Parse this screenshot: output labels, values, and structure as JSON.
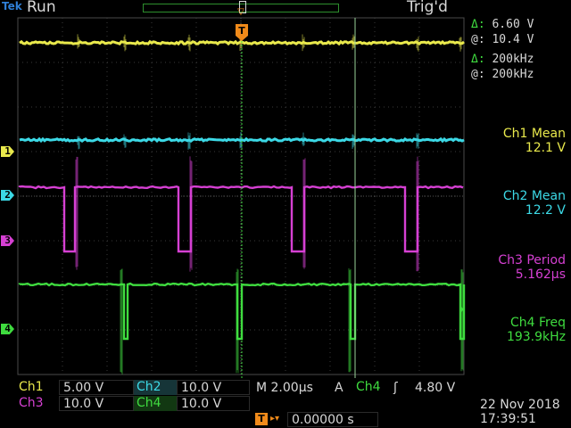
{
  "header": {
    "brand": "Tek",
    "run_status": "Run",
    "trigger_status": "Trig'd",
    "trigger_marker": "T"
  },
  "cursors": {
    "delta_v_symbol": "Δ:",
    "delta_v": "6.60 V",
    "at_v_symbol": "@:",
    "at_v": "10.4 V",
    "delta_f_symbol": "Δ:",
    "delta_f": "200kHz",
    "at_f_symbol": "@:",
    "at_f": "200kHz"
  },
  "measurements": [
    {
      "label": "Ch1 Mean",
      "value": "12.1 V",
      "color": "#e9e94c"
    },
    {
      "label": "Ch2 Mean",
      "value": "12.2 V",
      "color": "#3cd9e6"
    },
    {
      "label": "Ch3 Period",
      "value": "5.162µs",
      "color": "#d640d3"
    },
    {
      "label": "Ch4 Freq",
      "value": "193.9kHz",
      "color": "#3fdc3f"
    }
  ],
  "channel_markers": [
    {
      "label": "1",
      "color": "#e9e94c"
    },
    {
      "label": "2",
      "color": "#3cd9e6"
    },
    {
      "label": "3",
      "color": "#d640d3"
    },
    {
      "label": "4",
      "color": "#3fdc3f"
    }
  ],
  "settings": {
    "ch1_label": "Ch1",
    "ch1_scale": "5.00 V",
    "ch2_label": "Ch2",
    "ch2_scale": "10.0 V",
    "ch3_label": "Ch3",
    "ch3_scale": "10.0 V",
    "ch4_label": "Ch4",
    "ch4_scale": "10.0 V",
    "timebase": "M 2.00µs",
    "trigger_mode": "A",
    "trigger_source": "Ch4",
    "trigger_slope": "ʃ",
    "trigger_level": "4.80 V",
    "trigger_position": "0.00000 s"
  },
  "datetime": {
    "date": "22 Nov 2018",
    "time": "17:39:51"
  }
}
